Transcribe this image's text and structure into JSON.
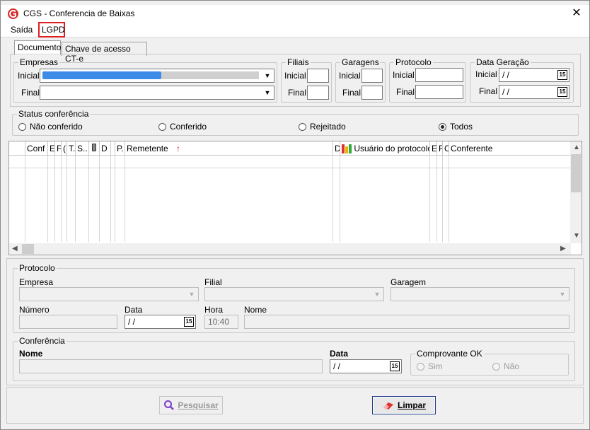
{
  "window": {
    "title": "CGS - Conferencia de Baixas",
    "close_glyph": "✕"
  },
  "menu": {
    "items": [
      "Saída",
      "LGPD"
    ]
  },
  "tabs": [
    "Documento",
    "Chave de acesso CT-e"
  ],
  "filters": {
    "empresas": {
      "legend": "Empresas",
      "inicial_label": "Inicial",
      "final_label": "Final"
    },
    "filiais": {
      "legend": "Filiais",
      "inicial_label": "Inicial",
      "final_label": "Final"
    },
    "garagens": {
      "legend": "Garagens",
      "inicial_label": "Inicial",
      "final_label": "Final"
    },
    "protocolo": {
      "legend": "Protocolo",
      "inicial_label": "Inicial",
      "final_label": "Final"
    },
    "data_geracao": {
      "legend": "Data Geração",
      "inicial_label": "Inicial",
      "final_label": "Final",
      "inicial_value": " /  /",
      "final_value": " /  /"
    }
  },
  "status": {
    "legend": "Status conferência",
    "options": [
      "Não conferido",
      "Conferido",
      "Rejeitado",
      "Todos"
    ],
    "selected": "Todos"
  },
  "grid": {
    "columns": [
      "",
      "Conf",
      "E",
      "F",
      "(",
      "T.",
      "S..",
      "",
      "D",
      "",
      "P.",
      "Remetente",
      "D",
      "Usuário do protocolo",
      "E",
      "F",
      "C",
      "Conferente"
    ]
  },
  "protocolo_detail": {
    "legend": "Protocolo",
    "empresa_label": "Empresa",
    "filial_label": "Filial",
    "garagem_label": "Garagem",
    "numero_label": "Número",
    "data_label": "Data",
    "hora_label": "Hora",
    "nome_label": "Nome",
    "data_value": " /  /",
    "hora_value": "10:40"
  },
  "conferencia": {
    "legend": "Conferência",
    "nome_label": "Nome",
    "data_label": "Data",
    "data_value": " /  /",
    "comprovante": {
      "legend": "Comprovante OK",
      "options": [
        "Sim",
        "Não"
      ]
    }
  },
  "buttons": {
    "pesquisar": "Pesquisar",
    "limpar": "Limpar"
  },
  "colors": {
    "highlight": "#e02020",
    "accent": "#1e6fd9"
  }
}
